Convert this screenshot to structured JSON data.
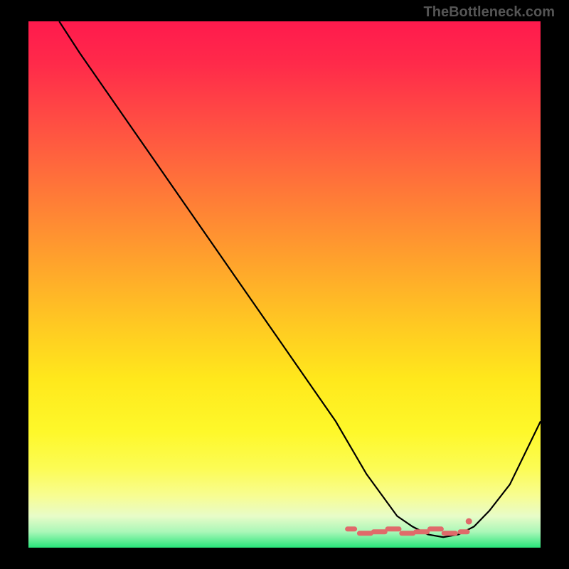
{
  "watermark": "TheBottleneck.com",
  "chart_data": {
    "type": "line",
    "title": "",
    "xlabel": "",
    "ylabel": "",
    "xlim": [
      0,
      100
    ],
    "ylim": [
      0,
      100
    ],
    "x": [
      6,
      10,
      15,
      20,
      25,
      30,
      35,
      40,
      45,
      50,
      55,
      60,
      63,
      66,
      69,
      72,
      75,
      78,
      81,
      84,
      87,
      90,
      94,
      100
    ],
    "y": [
      100,
      94,
      87,
      80,
      73,
      66,
      59,
      52,
      45,
      38,
      31,
      24,
      19,
      14,
      10,
      6,
      4,
      2.5,
      2,
      2.5,
      4,
      7,
      12,
      24
    ],
    "annotations": {
      "note": "Pink dashed markers near valley bottom",
      "marker_x_range": [
        63,
        85
      ],
      "marker_y": 3
    }
  }
}
